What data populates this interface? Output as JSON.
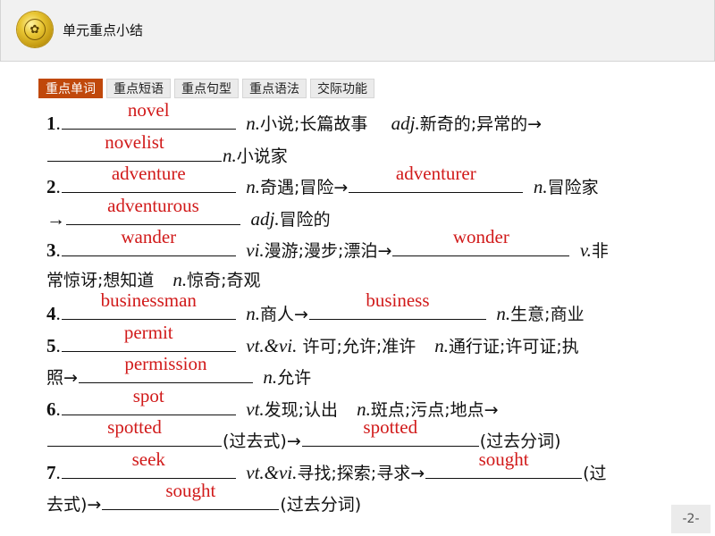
{
  "header": {
    "title": "单元重点小结",
    "logo_icon": "school-emblem-icon"
  },
  "tabs": [
    {
      "label": "重点单词",
      "active": true
    },
    {
      "label": "重点短语",
      "active": false
    },
    {
      "label": "重点句型",
      "active": false
    },
    {
      "label": "重点语法",
      "active": false
    },
    {
      "label": "交际功能",
      "active": false
    }
  ],
  "items": {
    "i1": {
      "num": "1",
      "ans1": "novel",
      "t1": "n.",
      "t2": "小说;长篇故事",
      "t3": "adj.",
      "t4": "新奇的;异常的→",
      "ans2": "novelist",
      "t5": "n.",
      "t6": "小说家"
    },
    "i2": {
      "num": "2",
      "ans1": "adventure",
      "t1": "n.",
      "t2": "奇遇;冒险→",
      "ans2": "adventurer",
      "t3": "n.",
      "t4": "冒险家",
      "t5": "→",
      "ans3": "adventurous",
      "t6": "adj.",
      "t7": "冒险的"
    },
    "i3": {
      "num": "3",
      "ans1": "wander",
      "t1": "vi.",
      "t2": "漫游;漫步;漂泊→",
      "ans2": "wonder",
      "t3": "v.",
      "t4": "非",
      "t5": "常惊讶;想知道",
      "t6": "n.",
      "t7": "惊奇;奇观"
    },
    "i4": {
      "num": "4",
      "ans1": "businessman",
      "t1": "n.",
      "t2": "商人→",
      "ans2": "business",
      "t3": "n.",
      "t4": "生意;商业"
    },
    "i5": {
      "num": "5",
      "ans1": "permit",
      "t1": "vt.&vi.",
      "t2": " 许可;允许;准许",
      "t3": "n.",
      "t4": "通行证;许可证;执",
      "t5": "照→",
      "ans2": "permission",
      "t6": "n.",
      "t7": "允许"
    },
    "i6": {
      "num": "6",
      "ans1": "spot",
      "t1": "vt.",
      "t2": "发现;认出",
      "t3": "n.",
      "t4": "斑点;污点;地点→",
      "ans2": "spotted",
      "t5": "(过去式)→",
      "ans3": "spotted",
      "t6": "(过去分词)"
    },
    "i7": {
      "num": "7",
      "ans1": "seek",
      "t1": "vt.&vi.",
      "t2": "寻找;探索;寻求→",
      "ans2": "sought",
      "t3": "(过",
      "t4": "去式)→",
      "ans3": "sought",
      "t5": "(过去分词)"
    }
  },
  "page": {
    "number": "-2-"
  },
  "colors": {
    "answer": "#d11a1a",
    "active_tab": "#c0480b"
  }
}
